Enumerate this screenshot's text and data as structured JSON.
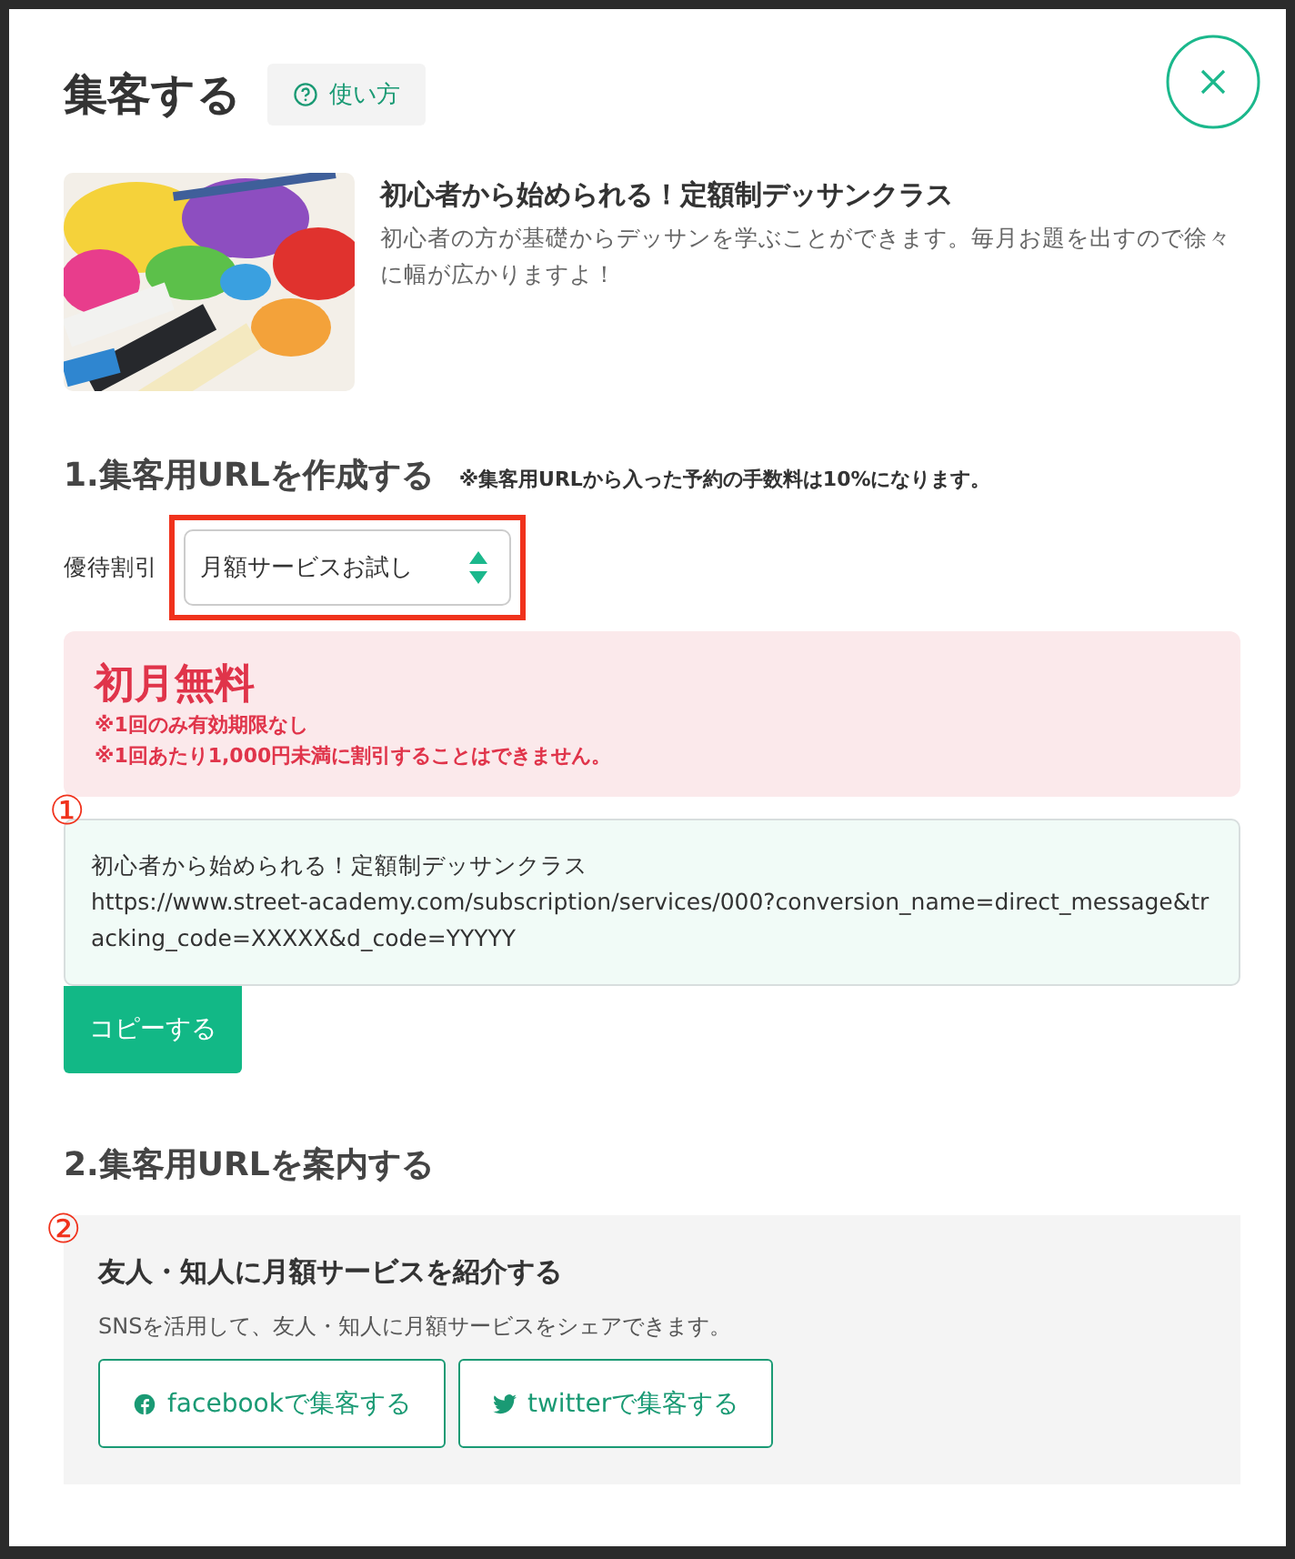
{
  "modal": {
    "title": "集客する",
    "help_button": "使い方"
  },
  "course": {
    "title": "初心者から始められる！定額制デッサンクラス",
    "description": "初心者の方が基礎からデッサンを学ぶことができます。毎月お題を出すので徐々に幅が広かりますよ！"
  },
  "section_1": {
    "heading": "1.集客用URLを作成する",
    "note": "※集客用URLから入った予約の手数料は10%になります。",
    "discount": {
      "label": "優待割引",
      "value": "月額サービスお試し",
      "highlighted": true
    },
    "offer": {
      "title": "初月無料",
      "notes": [
        "※1回のみ有効期限なし",
        "※1回あたり1,000円未満に割引することはできません。"
      ]
    },
    "url_box": {
      "marker": "①",
      "title": "初心者から始められる！定額制デッサンクラス",
      "url": "https://www.street-academy.com/subscription/services/000?conversion_name=direct_message&tracking_code=XXXXX&d_code=YYYYY"
    },
    "copy_button": "コピーする"
  },
  "section_2": {
    "heading": "2.集客用URLを案内する",
    "marker": "②",
    "card": {
      "title": "友人・知人に月額サービスを紹介する",
      "description": "SNSを活用して、友人・知人に月額サービスをシェアできます。",
      "buttons": [
        {
          "kind": "facebook",
          "label": "facebookで集客する"
        },
        {
          "kind": "twitter",
          "label": "twitterで集客する"
        }
      ]
    }
  }
}
